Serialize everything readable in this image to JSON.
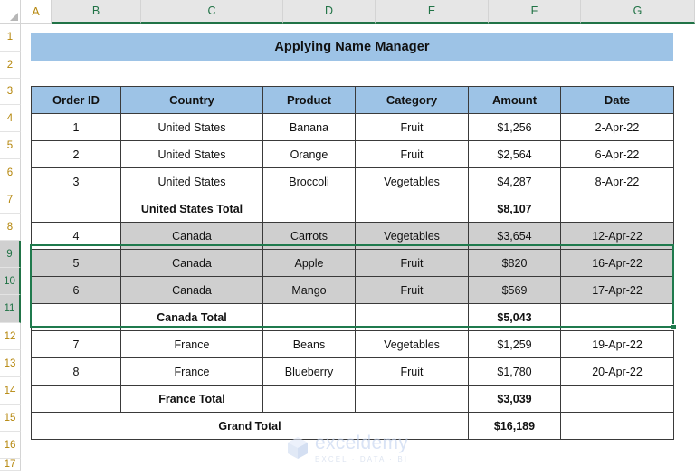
{
  "app": {
    "kind": "spreadsheet",
    "colors": {
      "header_fill": "#9DC3E6",
      "selection_green": "#1F7A4D",
      "selected_row_fill": "#CFCFCF",
      "grid_line": "#3A3A3A",
      "row_header_text": "#B5860B",
      "col_header_selected_fill": "#E6E6E6"
    }
  },
  "column_headers": [
    {
      "label": "A",
      "selected": false
    },
    {
      "label": "B",
      "selected": true
    },
    {
      "label": "C",
      "selected": true
    },
    {
      "label": "D",
      "selected": true
    },
    {
      "label": "E",
      "selected": true
    },
    {
      "label": "F",
      "selected": true
    },
    {
      "label": "G",
      "selected": true
    }
  ],
  "row_headers": [
    {
      "label": "1",
      "selected": false
    },
    {
      "label": "2",
      "selected": false
    },
    {
      "label": "3",
      "selected": false
    },
    {
      "label": "4",
      "selected": false
    },
    {
      "label": "5",
      "selected": false
    },
    {
      "label": "6",
      "selected": false
    },
    {
      "label": "7",
      "selected": false
    },
    {
      "label": "8",
      "selected": false
    },
    {
      "label": "9",
      "selected": true
    },
    {
      "label": "10",
      "selected": true
    },
    {
      "label": "11",
      "selected": true
    },
    {
      "label": "12",
      "selected": false
    },
    {
      "label": "13",
      "selected": false
    },
    {
      "label": "14",
      "selected": false
    },
    {
      "label": "15",
      "selected": false
    },
    {
      "label": "16",
      "selected": false
    },
    {
      "label": "17",
      "selected": false
    }
  ],
  "title": {
    "text": "Applying Name Manager"
  },
  "table": {
    "headers": [
      "Order ID",
      "Country",
      "Product",
      "Category",
      "Amount",
      "Date"
    ],
    "rows": [
      {
        "type": "data",
        "selected": false,
        "active_cell": false,
        "cells": [
          "1",
          "United States",
          "Banana",
          "Fruit",
          "$1,256",
          "2-Apr-22"
        ]
      },
      {
        "type": "data",
        "selected": false,
        "active_cell": false,
        "cells": [
          "2",
          "United States",
          "Orange",
          "Fruit",
          "$2,564",
          "6-Apr-22"
        ]
      },
      {
        "type": "data",
        "selected": false,
        "active_cell": false,
        "cells": [
          "3",
          "United States",
          "Broccoli",
          "Vegetables",
          "$4,287",
          "8-Apr-22"
        ]
      },
      {
        "type": "total",
        "selected": false,
        "active_cell": false,
        "cells": [
          "",
          "United States Total",
          "",
          "",
          "$8,107",
          ""
        ]
      },
      {
        "type": "data",
        "selected": true,
        "active_cell": true,
        "cells": [
          "4",
          "Canada",
          "Carrots",
          "Vegetables",
          "$3,654",
          "12-Apr-22"
        ]
      },
      {
        "type": "data",
        "selected": true,
        "active_cell": false,
        "cells": [
          "5",
          "Canada",
          "Apple",
          "Fruit",
          "$820",
          "16-Apr-22"
        ]
      },
      {
        "type": "data",
        "selected": true,
        "active_cell": false,
        "cells": [
          "6",
          "Canada",
          "Mango",
          "Fruit",
          "$569",
          "17-Apr-22"
        ]
      },
      {
        "type": "total",
        "selected": false,
        "active_cell": false,
        "cells": [
          "",
          "Canada Total",
          "",
          "",
          "$5,043",
          ""
        ]
      },
      {
        "type": "data",
        "selected": false,
        "active_cell": false,
        "cells": [
          "7",
          "France",
          "Beans",
          "Vegetables",
          "$1,259",
          "19-Apr-22"
        ]
      },
      {
        "type": "data",
        "selected": false,
        "active_cell": false,
        "cells": [
          "8",
          "France",
          "Blueberry",
          "Fruit",
          "$1,780",
          "20-Apr-22"
        ]
      },
      {
        "type": "total",
        "selected": false,
        "active_cell": false,
        "cells": [
          "",
          "France Total",
          "",
          "",
          "$3,039",
          ""
        ]
      }
    ],
    "grand_total": {
      "label": "Grand Total",
      "amount": "$16,189",
      "trailing": ""
    }
  },
  "selection": {
    "range": "B9:G11",
    "has_fill_handle": true
  },
  "watermark": {
    "name": "exceldemy",
    "subtitle": "EXCEL · DATA · BI"
  }
}
